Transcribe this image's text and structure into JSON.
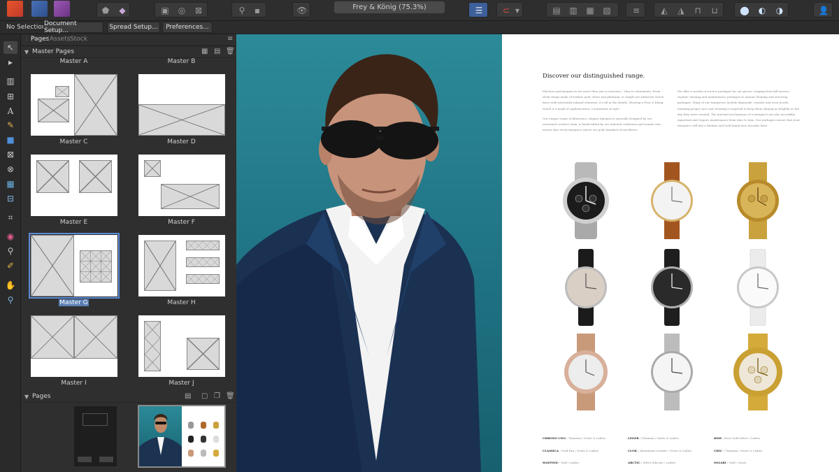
{
  "toolbar": {
    "document_title": "Frey & König (75.3%)"
  },
  "context": {
    "selection_label": "No Selection",
    "document_setup": "Document Setup...",
    "spread_setup": "Spread Setup...",
    "preferences": "Preferences..."
  },
  "panel": {
    "tabs": [
      "Pages",
      "Assets",
      "Stock"
    ],
    "master_section": "Master Pages",
    "pages_section": "Pages",
    "masters": [
      {
        "top": "Master A",
        "bottom": "Master C"
      },
      {
        "top": "Master B",
        "bottom": "Master D"
      },
      {
        "bottom": "Master E"
      },
      {
        "bottom": "Master F"
      },
      {
        "bottom": "Master G"
      },
      {
        "bottom": "Master H"
      },
      {
        "bottom": "Master I"
      },
      {
        "bottom": "Master J"
      }
    ]
  },
  "spread": {
    "heading": "Discover our distinguished range.",
    "col1_p1": "Watches and timepieces are more than just accessories – they're statements. From sleek straps made of leather, gold, silver and platinum, to simple yet elaborate watch faces with intricately inlayed elements, it's all in the details. Wearing a Frey & König watch is a mark of sophistication, a statement of style.",
    "col1_p2": "Our unique range of illustrious, elegant timepieces specially designed by our renowned creative team, is handcrafted by our talented craftsmen and women who ensure that every timepiece meets our gold standard of excellence.",
    "col2_p1": "We offer a variety of service packages for our pieces, ranging from full-service, regular cleaning and maintenance packages to annual cleaning and servicing packages. Many of our timepieces include diamonds, crystals and even jewels, meaning proper care and cleaning is required to keep them shining as brightly as the day they were created. The internal mechanisms of a timepiece are also incredibly important and require maintenance from time to time. Our packages ensure that your timepiece will last a lifetime and look brand new, decades later.",
    "captions": [
      {
        "name": "CHRONO UNO",
        "desc": " / Titanium / Gents & Ladies"
      },
      {
        "name": "LEGER",
        "desc": " / Titanium / Gents & Ladies"
      },
      {
        "name": "RISE",
        "desc": " / Rose Gold Silver / Ladies"
      },
      {
        "name": "CLASSICA",
        "desc": " / Gold Fan / Gents & Ladies"
      },
      {
        "name": "CLOK",
        "desc": " / Aluminium Leather / Gents & Ladies"
      },
      {
        "name": "CHIC",
        "desc": " / Titanium / Gents & Ladies"
      },
      {
        "name": "WAYFIND",
        "desc": " / Gold / Ladies"
      },
      {
        "name": "ARCTIC",
        "desc": " / Silver Silicone / Ladies"
      },
      {
        "name": "SOLARI",
        "desc": " / Gold / Gents"
      }
    ]
  },
  "colors": {
    "selection_blue": "#5b8bd6",
    "accent_red": "#c0392b"
  }
}
